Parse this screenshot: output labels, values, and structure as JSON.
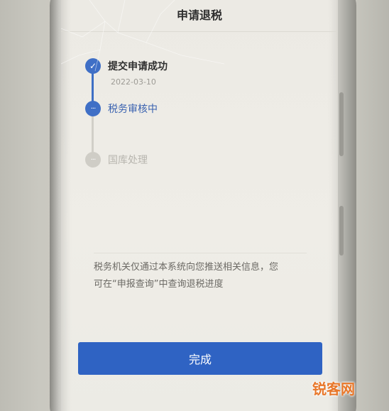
{
  "header": {
    "title": "申请退税"
  },
  "steps": [
    {
      "label": "提交申请成功",
      "date": "2022-03-10",
      "status": "done",
      "icon": "check-icon"
    },
    {
      "label": "税务审核中",
      "status": "active",
      "icon": "more-icon"
    },
    {
      "label": "国库处理",
      "status": "pending",
      "icon": "more-icon"
    }
  ],
  "notice": {
    "line1": "税务机关仅通过本系统向您推送相关信息，您",
    "line2": "可在“申报查询”中查询退税进度"
  },
  "actions": {
    "done_label": "完成"
  },
  "watermark": {
    "text": "锐客网"
  },
  "colors": {
    "accent": "#2f63c3",
    "pending": "#cfcdc6"
  },
  "icons": {
    "done": "✓",
    "more": "···"
  }
}
